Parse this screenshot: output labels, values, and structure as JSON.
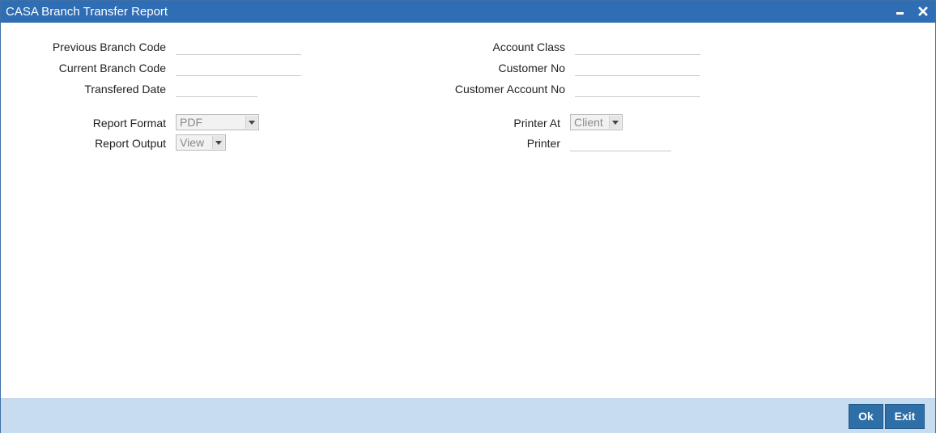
{
  "window": {
    "title": "CASA Branch Transfer Report",
    "minimize_icon": "minimize-icon",
    "close_icon": "close-icon"
  },
  "form": {
    "previous_branch_code": {
      "label": "Previous Branch Code",
      "value": ""
    },
    "current_branch_code": {
      "label": "Current Branch Code",
      "value": ""
    },
    "transfered_date": {
      "label": "Transfered Date",
      "value": ""
    },
    "account_class": {
      "label": "Account Class",
      "value": ""
    },
    "customer_no": {
      "label": "Customer No",
      "value": ""
    },
    "customer_account_no": {
      "label": "Customer Account No",
      "value": ""
    },
    "report_format": {
      "label": "Report Format",
      "value": "PDF"
    },
    "report_output": {
      "label": "Report Output",
      "value": "View"
    },
    "printer_at": {
      "label": "Printer At",
      "value": "Client"
    },
    "printer": {
      "label": "Printer",
      "value": ""
    }
  },
  "footer": {
    "ok_label": "Ok",
    "exit_label": "Exit"
  },
  "colors": {
    "titlebar": "#2f6db4",
    "footer": "#c7dcef",
    "button": "#2f6fa7"
  }
}
